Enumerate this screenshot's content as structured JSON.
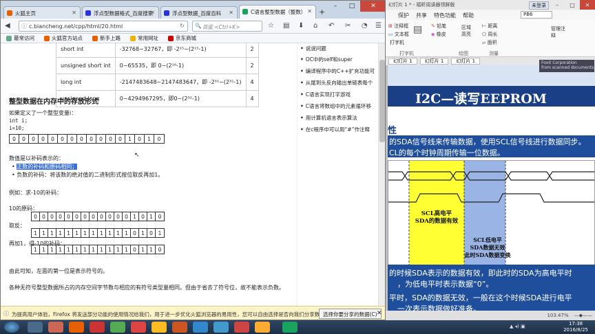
{
  "firefox": {
    "tabs": [
      {
        "label": "火狐主页",
        "color": "#e66000"
      },
      {
        "label": "浮点型数据格式_百度搜索",
        "color": "#2932e1"
      },
      {
        "label": "浮点型数据_百度百科",
        "color": "#2932e1"
      },
      {
        "label": "C语言整型数据（整数）",
        "color": "#1aa260"
      }
    ],
    "url": "c.biancheng.net/cpp/html/20.html",
    "search_placeholder": "百度 <Ctrl+K>",
    "bookmarks": [
      {
        "label": "最常访问",
        "color": "#6a8"
      },
      {
        "label": "火狐官方站点",
        "color": "#e66000"
      },
      {
        "label": "新手上路",
        "color": "#e66000"
      },
      {
        "label": "常用网址",
        "color": "#f0b400"
      },
      {
        "label": "京东商城",
        "color": "#c00"
      }
    ],
    "notice": "为提高用户体验，Firefox 将发送部分功能的使用情况给我们，用于进一步优化火狐浏览器的易用性，您可以自由选择是否向我们分享数据。",
    "notice_button": "选择你要分享的数据(C)"
  },
  "article": {
    "table": [
      [
        "short int",
        "-32768~32767，即 -2¹⁵~(2¹⁵-1)",
        "2"
      ],
      [
        "unsigned short int",
        "0~65535，即 0~(2¹⁶-1)",
        "2"
      ],
      [
        "long int",
        "-2147483648~2147483647，即 -2³¹~(2³¹-1)",
        "4"
      ],
      [
        "unsigned long",
        "0~4294967295，即0~(2³²-1)",
        "4"
      ]
    ],
    "heading": "整型数据在内存中的存放形式",
    "p1": "如果定义了一个整型变量i：",
    "code1": "int i;",
    "code2": "i=10;",
    "bits_10": [
      "0",
      "0",
      "0",
      "0",
      "0",
      "0",
      "0",
      "0",
      "0",
      "0",
      "0",
      "0",
      "1",
      "0",
      "1",
      "0"
    ],
    "p2": "数值是以补码表示的：",
    "li1": "正数的补码和原码相同；",
    "li2": "负数的补码：将该数的绝对值的二进制形式按位取反再加1。",
    "example": "例如：求-10的补码：",
    "label_orig": "10的原码：",
    "bits_orig": [
      "0",
      "0",
      "0",
      "0",
      "0",
      "0",
      "0",
      "0",
      "0",
      "0",
      "0",
      "0",
      "1",
      "0",
      "1",
      "0"
    ],
    "label_inv": "取反：",
    "bits_inv": [
      "1",
      "1",
      "1",
      "1",
      "1",
      "1",
      "1",
      "1",
      "1",
      "1",
      "1",
      "1",
      "0",
      "1",
      "0",
      "1"
    ],
    "label_add": "再加1，得-10的补码：",
    "bits_add": [
      "1",
      "1",
      "1",
      "1",
      "1",
      "1",
      "1",
      "1",
      "1",
      "1",
      "1",
      "1",
      "0",
      "1",
      "1",
      "0"
    ],
    "p3": "由此可知，左面的第一位是表示符号的。",
    "p4": "各种无符号整型数据所占的内存空间字节数与相应的有符号类型量相同。但由于省去了符号位，故不能表示负数。"
  },
  "sidebar": [
    "说说问题",
    "OC中的self和super",
    "编译程序中的C++扩充功能可",
    "从尾到头反向输出单链表每个",
    "C语言实现打字游戏",
    "C语言将数组中的元素循环移",
    "用计算机语言表示算法",
    "在c程序中可以用“#”作注释"
  ],
  "ppt": {
    "title": "幻灯片 1 * - 福昕阅读器领鲜版",
    "user": "未登录",
    "tabs": [
      "保护",
      "共享",
      "特色功能",
      "帮助"
    ],
    "search": "PB6",
    "ribbon_items": [
      "注释框",
      "文本框",
      "打字机",
      "铅笔",
      "橡皮",
      "区域高亮",
      "距离",
      "周长",
      "面积",
      "管理注释"
    ],
    "groups": [
      "打字机",
      "绘图",
      "测量"
    ],
    "doc_tabs": [
      "幻灯片 1",
      "幻灯片 1",
      "幻灯片 1"
    ],
    "title_text": "I2C—读写EEPROM",
    "subhead": "性",
    "line1": "的SDA信号线来传输数据，使用SCL信号线进行数据同步。",
    "line2": "CL的每个时钟周期传输一位数据。",
    "label_high": "SCL高电平\nSDA的数据有效",
    "label_low": "SCL低电平\nSDA数据无效\n此时SDA数据变换",
    "bottom1": "的时候SDA表示的数据有效，即此时的SDA为高电平时",
    "bottom2": "，为低电平时表示数据“0”。",
    "bottom3": "平时，SDA的数据无效，一般在这个时候SDA进行电平",
    "bottom4": "一次表示数据做好准备。",
    "zoom": "103.47%",
    "watermark": "Foxit Corporation\nfrom scanned documents"
  },
  "taskbar": {
    "time": "17:38",
    "date": "2016/8/25"
  }
}
